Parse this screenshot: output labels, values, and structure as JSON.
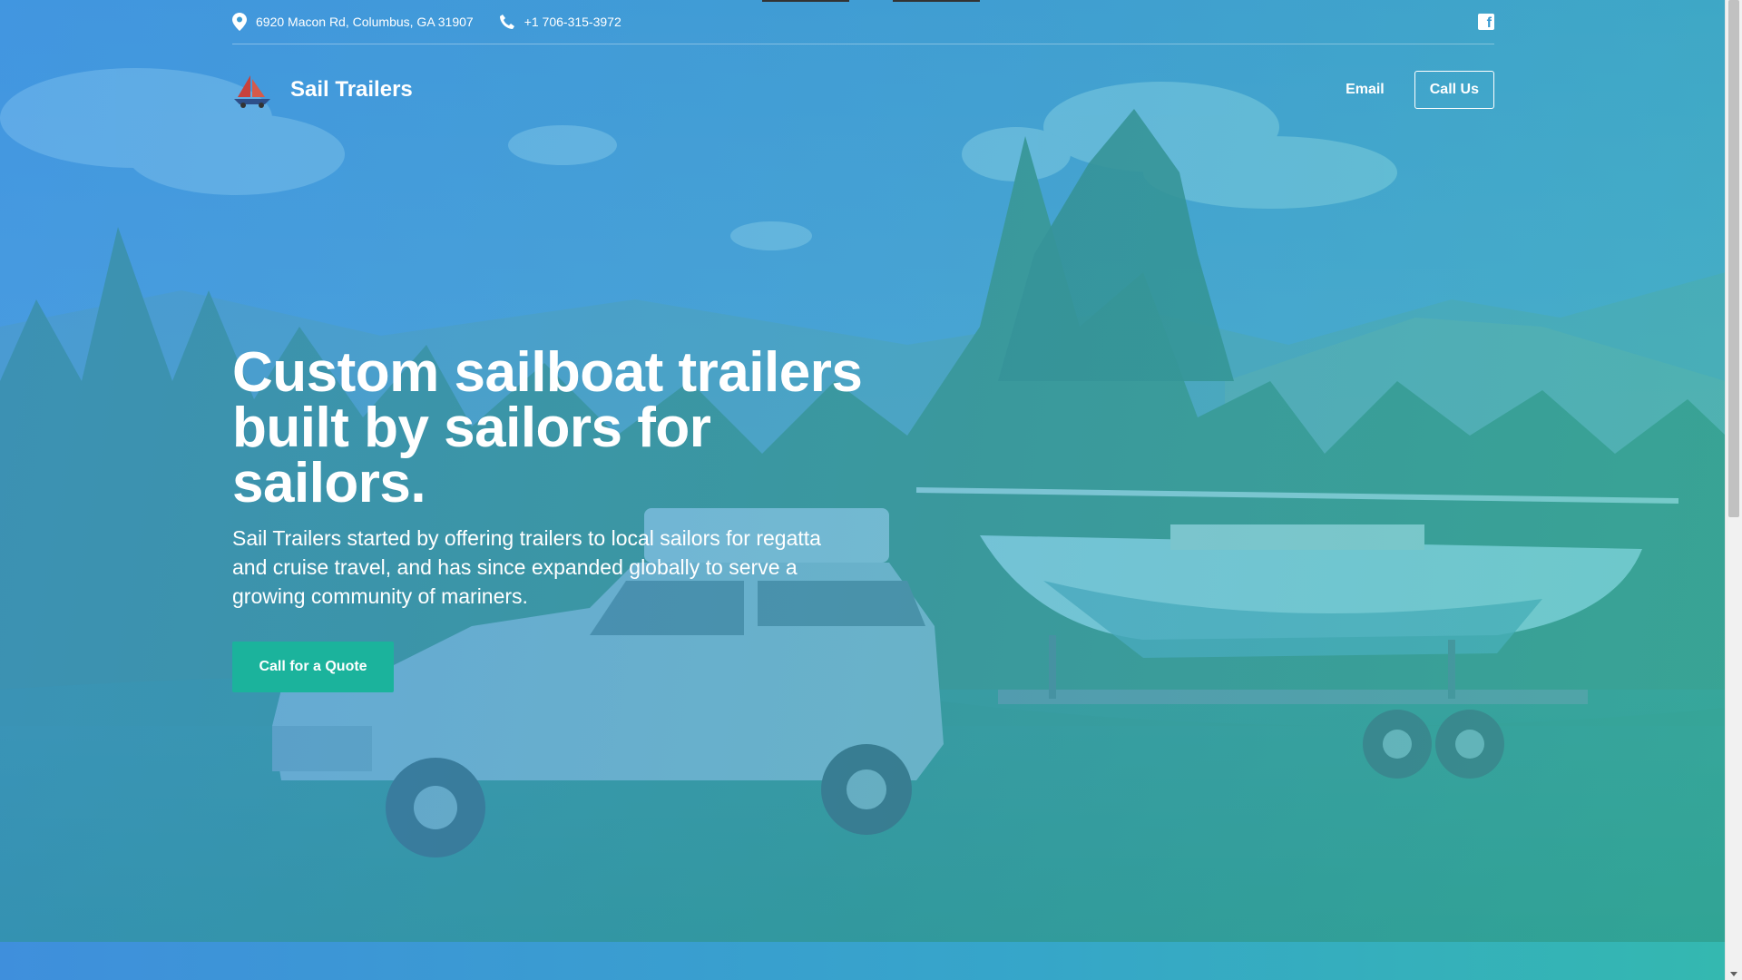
{
  "topbar": {
    "address": "6920 Macon Rd, Columbus, GA 31907",
    "phone": "+1 706-315-3972",
    "social_icon": "facebook-icon"
  },
  "nav": {
    "brand": "Sail Trailers",
    "email_label": "Email",
    "call_label": "Call Us"
  },
  "hero": {
    "headline": "Custom sailboat trailers built by sailors for sailors.",
    "subhead": "Sail Trailers started by offering trailers to local sailors for regatta and cruise travel, and has since expanded globally to serve a growing community of mariners.",
    "cta_label": "Call for a Quote",
    "background": "photo of pickup truck towing a sailboat on a trailer in a mountain meadow"
  },
  "colors": {
    "cta": "#1bb39c",
    "tint_left": "#3a96e6",
    "tint_right": "#32beaf",
    "text": "#ffffff"
  }
}
